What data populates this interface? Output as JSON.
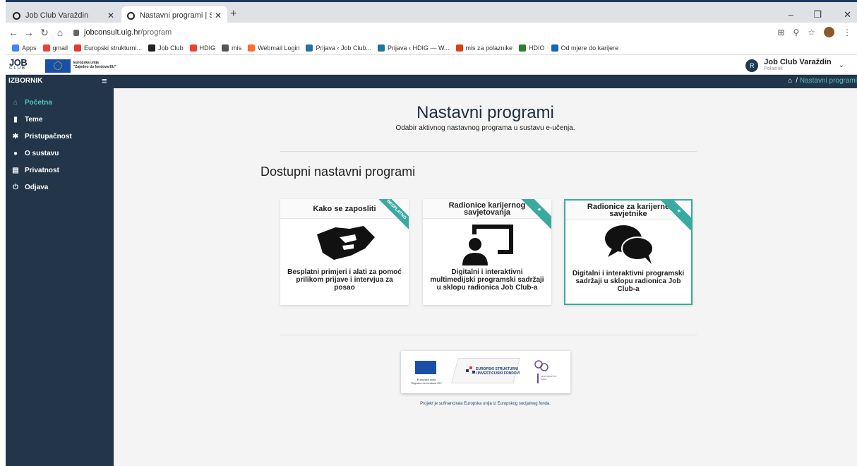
{
  "browser": {
    "tabs": [
      {
        "title": "Job Club Varaždin",
        "active": false
      },
      {
        "title": "Nastavni programi | Sustav e-uče",
        "active": true
      }
    ],
    "new_tab_glyph": "+",
    "window_controls": [
      "–",
      "❐",
      "✕"
    ],
    "url_host": "jobconsult.uig.hr",
    "url_path": "/program",
    "bookmarks": [
      {
        "label": "Apps",
        "icon": "apps-grid-icon",
        "color": "#4285f4"
      },
      {
        "label": "gmail",
        "icon": "gmail-icon",
        "color": "#ea4335"
      },
      {
        "label": "Europski strukturni...",
        "icon": "eu-funds-icon",
        "color": "#e53935"
      },
      {
        "label": "Job Club",
        "icon": "job-club-icon",
        "color": "#222222"
      },
      {
        "label": "HDIG",
        "icon": "google-icon",
        "color": "#ea4335"
      },
      {
        "label": "mis",
        "icon": "globe-icon",
        "color": "#555555"
      },
      {
        "label": "Webmail Login",
        "icon": "cpanel-icon",
        "color": "#ff6c2c"
      },
      {
        "label": "Prijava ‹ Job Club...",
        "icon": "wordpress-icon",
        "color": "#21759b"
      },
      {
        "label": "Prijava ‹ HDIG — W...",
        "icon": "wordpress-icon",
        "color": "#21759b"
      },
      {
        "label": "mis za polaznike",
        "icon": "mis-icon",
        "color": "#d84315"
      },
      {
        "label": "HDIO",
        "icon": "hdio-icon",
        "color": "#2e7d32"
      },
      {
        "label": "Od mjere do karijere",
        "icon": "career-icon",
        "color": "#1565c0"
      }
    ]
  },
  "header": {
    "logo_job": "JOB",
    "logo_club": "CLUB",
    "eu_line1": "Europska unija",
    "eu_line2": "\"Zajedno do fondova EU\"",
    "user_initial": "R",
    "user_name": "Job Club Varaždin",
    "user_role": "Polaznik"
  },
  "topbar": {
    "brand": "IZBORNIK",
    "breadcrumb_separator": "/",
    "breadcrumb_current": "Nastavni programi"
  },
  "sidebar": {
    "items": [
      {
        "label": "Početna",
        "icon": "home-icon",
        "glyph": "⌂",
        "active": true
      },
      {
        "label": "Teme",
        "icon": "copy-icon",
        "glyph": "▮",
        "active": false
      },
      {
        "label": "Pristupačnost",
        "icon": "gear-icon",
        "glyph": "✱",
        "active": false
      },
      {
        "label": "O sustavu",
        "icon": "info-icon",
        "glyph": "●",
        "active": false
      },
      {
        "label": "Privatnost",
        "icon": "document-icon",
        "glyph": "▤",
        "active": false
      },
      {
        "label": "Odjava",
        "icon": "power-icon",
        "glyph": "⏻",
        "active": false
      }
    ]
  },
  "main": {
    "title": "Nastavni programi",
    "subtitle": "Odabir aktivnog nastavnog programa u sustavu e-učenja.",
    "section_title": "Dostupni nastavni programi",
    "cards": [
      {
        "title": "Kako se zaposliti",
        "ribbon": "BESPLATNO",
        "icon": "handshake-icon",
        "description": "Besplatni primjeri i alati za pomoć prilikom prijave i intervjua za posao",
        "selected": false
      },
      {
        "title": "Radionice karijernog savjetovanja",
        "ribbon": "★",
        "icon": "chalkboard-teacher-icon",
        "description": "Digitalni i interaktivni multimedijski programski sadržaji u sklopu radionica Job Club-a",
        "selected": false
      },
      {
        "title": "Radionice za karijerne savjetnike",
        "ribbon": "★",
        "icon": "comments-icon",
        "description": "Digitalni i interaktivni programski sadržaji u sklopu radionica Job Club-a",
        "selected": true
      }
    ],
    "footer_logos": {
      "eu_caption_1": "Europska unija",
      "eu_caption_2": "\"Zajedno do fondova EU\"",
      "esif_line1": "EUROPSKI STRUKTURNI",
      "esif_line2": "I INVESTICIJSKI FONDOVI",
      "ministry": "MINISTARSTVO RADA"
    },
    "footnote": "Projekt je sufinancirala Europska unija iz Europskog socijalnog fonda."
  },
  "colors": {
    "sidebar_bg": "#233649",
    "accent_teal": "#3aa9a0",
    "main_bg": "#f4f4f4"
  }
}
